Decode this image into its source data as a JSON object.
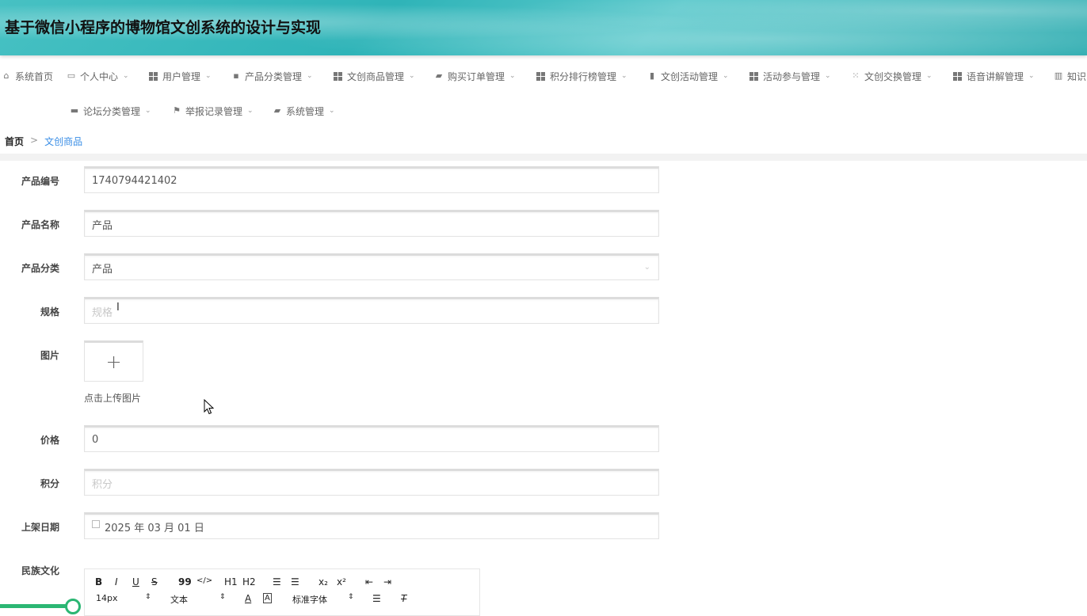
{
  "header": {
    "title": "基于微信小程序的博物馆文创系统的设计与实现"
  },
  "nav": {
    "row1": [
      {
        "label": "系统首页",
        "icon": "home-icon"
      },
      {
        "label": "个人中心",
        "icon": "card-icon"
      },
      {
        "label": "用户管理",
        "icon": "grid-icon"
      },
      {
        "label": "产品分类管理",
        "icon": "chat-icon"
      },
      {
        "label": "文创商品管理",
        "icon": "grid-icon"
      },
      {
        "label": "购买订单管理",
        "icon": "briefcase-icon"
      },
      {
        "label": "积分排行榜管理",
        "icon": "grid-icon"
      },
      {
        "label": "文创活动管理",
        "icon": "clipboard-icon"
      },
      {
        "label": "活动参与管理",
        "icon": "grid-icon"
      },
      {
        "label": "文创交换管理",
        "icon": "apps-icon"
      },
      {
        "label": "语音讲解管理",
        "icon": "grid-icon"
      },
      {
        "label": "知识",
        "icon": "book-icon"
      }
    ],
    "row2": [
      {
        "label": "论坛分类管理",
        "icon": "monitor-icon"
      },
      {
        "label": "举报记录管理",
        "icon": "flag-icon"
      },
      {
        "label": "系统管理",
        "icon": "toolbox-icon"
      }
    ]
  },
  "breadcrumb": {
    "home": "首页",
    "sep": ">",
    "current": "文创商品"
  },
  "form": {
    "product_no": {
      "label": "产品编号",
      "value": "1740794421402"
    },
    "product_name": {
      "label": "产品名称",
      "value": "产品"
    },
    "category": {
      "label": "产品分类",
      "value": "产品"
    },
    "spec": {
      "label": "规格",
      "placeholder": "规格"
    },
    "image": {
      "label": "图片",
      "plus": "+",
      "hint": "点击上传图片"
    },
    "price": {
      "label": "价格",
      "value": "0"
    },
    "points": {
      "label": "积分",
      "placeholder": "积分"
    },
    "date": {
      "label": "上架日期",
      "value": "2025 年 03 月 01 日"
    },
    "culture": {
      "label": "民族文化"
    }
  },
  "editor": {
    "row1": [
      "B",
      "I",
      "U",
      "S",
      "99",
      "</>",
      "H1",
      "H2",
      "ol",
      "ul",
      "x₂",
      "x²",
      "outdent",
      "indent"
    ],
    "font_size": "14px",
    "text_type": "文本",
    "font_family": "标准字体"
  }
}
